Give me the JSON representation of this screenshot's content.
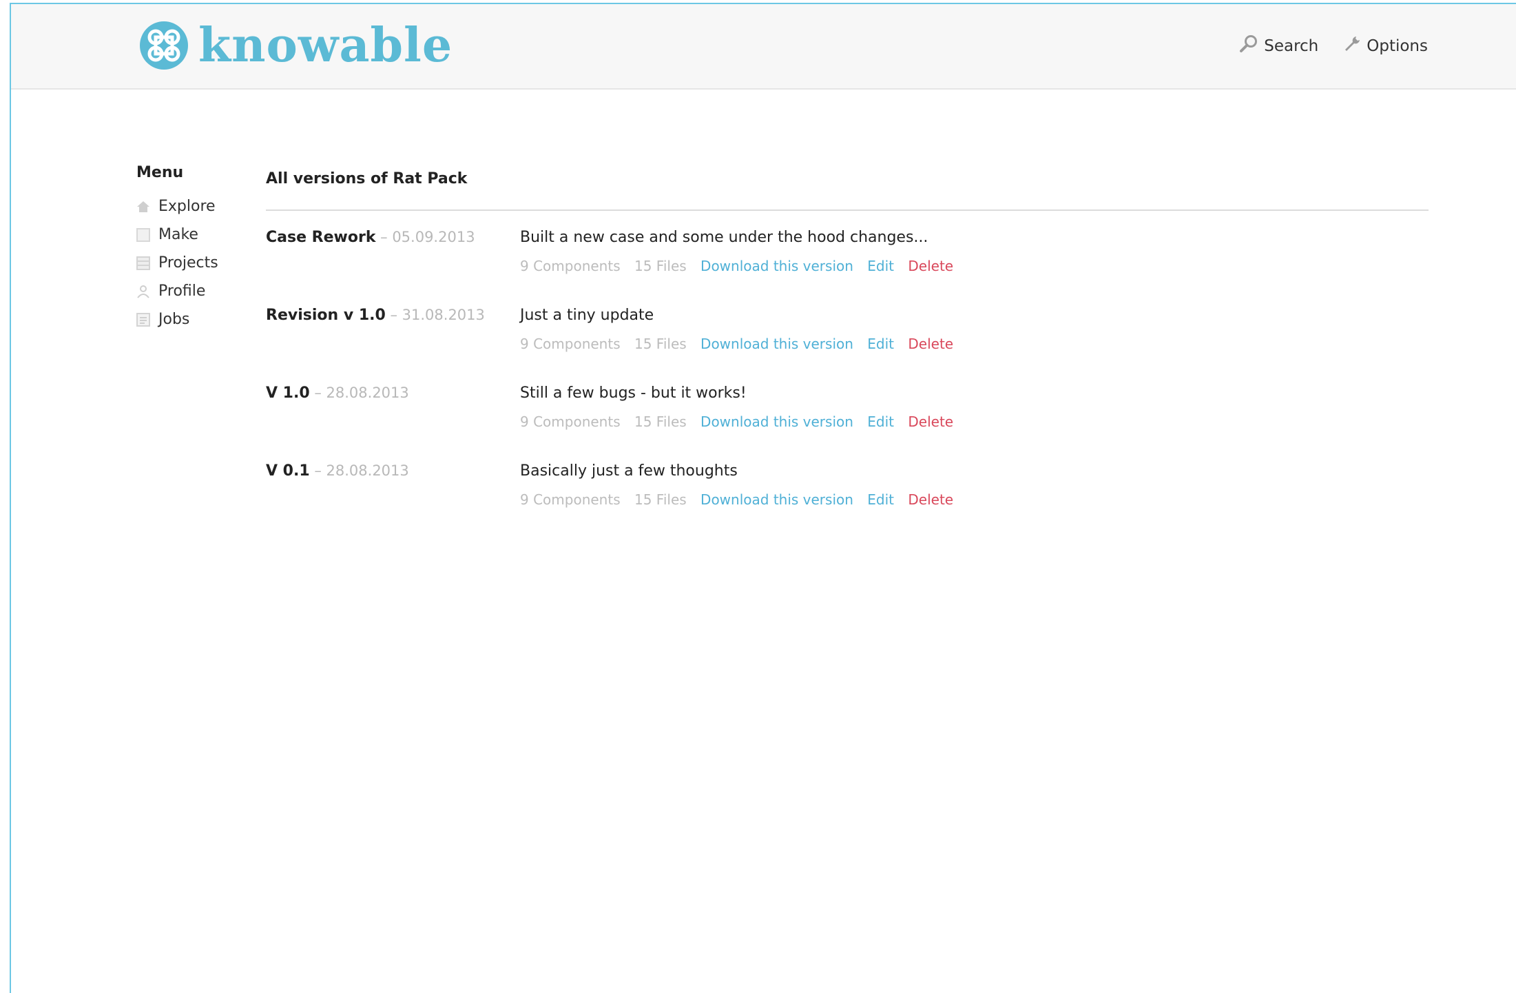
{
  "app": {
    "logo_text": "knowable",
    "brand_color": "#5bbad5",
    "frame_color": "#6cc7e4"
  },
  "topnav": {
    "search_label": "Search",
    "search_icon": "search-icon",
    "options_label": "Options",
    "options_icon": "wrench-icon"
  },
  "menu": {
    "title": "Menu",
    "items": [
      {
        "label": "Explore",
        "icon": "home-icon"
      },
      {
        "label": "Make",
        "icon": "square-icon"
      },
      {
        "label": "Projects",
        "icon": "grid-icon"
      },
      {
        "label": "Profile",
        "icon": "user-icon"
      },
      {
        "label": "Jobs",
        "icon": "list-icon"
      }
    ]
  },
  "main": {
    "title": "All versions of Rat Pack",
    "versions": [
      {
        "name": "Case Rework",
        "separator": " – ",
        "date": "05.09.2013",
        "description": "Built a new case and some under the hood changes...",
        "components": "9 Components",
        "files": "15 Files",
        "download_label": "Download this version",
        "edit_label": "Edit",
        "delete_label": "Delete"
      },
      {
        "name": "Revision v 1.0",
        "separator": " – ",
        "date": "31.08.2013",
        "description": "Just a tiny update",
        "components": "9 Components",
        "files": "15 Files",
        "download_label": "Download this version",
        "edit_label": "Edit",
        "delete_label": "Delete"
      },
      {
        "name": "V 1.0",
        "separator": " – ",
        "date": "28.08.2013",
        "description": "Still a few bugs - but it works!",
        "components": "9 Components",
        "files": "15 Files",
        "download_label": "Download this version",
        "edit_label": "Edit",
        "delete_label": "Delete"
      },
      {
        "name": "V 0.1",
        "separator": " – ",
        "date": "28.08.2013",
        "description": "Basically just a few thoughts",
        "components": "9 Components",
        "files": "15 Files",
        "download_label": "Download this version",
        "edit_label": "Edit",
        "delete_label": "Delete"
      }
    ]
  }
}
